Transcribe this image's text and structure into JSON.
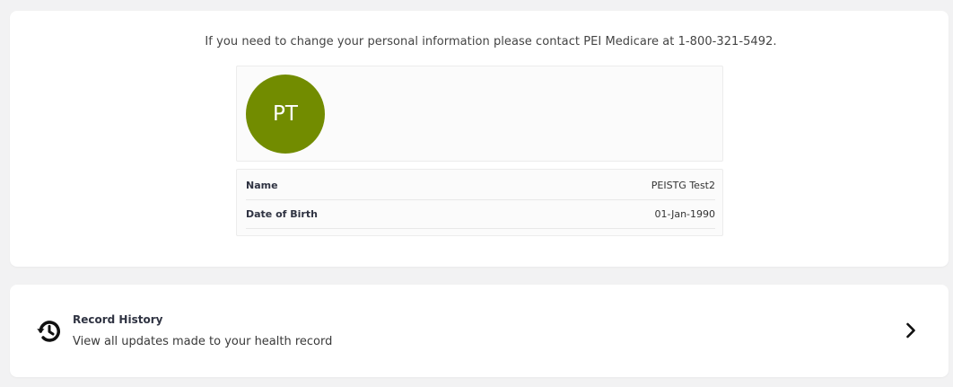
{
  "profile": {
    "notice": "If you need to change your personal information please contact PEI Medicare at 1-800-321-5492.",
    "avatar_initials": "PT",
    "avatar_color": "#728c00",
    "rows": [
      {
        "label": "Name",
        "value": "PEISTG Test2"
      },
      {
        "label": "Date of Birth",
        "value": "01-Jan-1990"
      }
    ]
  },
  "record_history": {
    "icon": "history-icon",
    "title": "Record History",
    "subtitle": "View all updates made to your health record",
    "action_icon": "chevron-right-icon"
  }
}
